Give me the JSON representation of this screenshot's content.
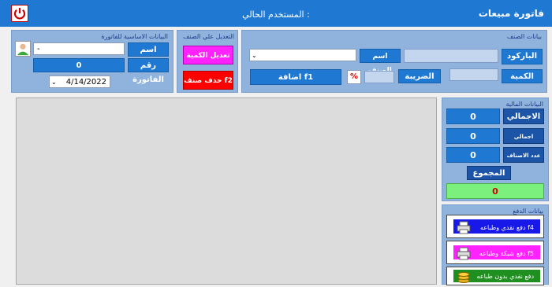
{
  "window": {
    "title": "فاتورة مبيعات",
    "current_user_label": "المستخدم الحالي :"
  },
  "item_data": {
    "heading": "بيانات الصنف",
    "barcode_label": "الباركود",
    "item_name_label": "اسم الصنف",
    "item_name_select": "",
    "quantity_label": "الكمية",
    "tax_label": "الضريبة",
    "percent_symbol": "%",
    "add_button": "اضافة      f1"
  },
  "edit_item": {
    "heading": "التعديل علي الصنف",
    "edit_qty_button": "تعديل الكمية  f3",
    "delete_item_button": "حذف صنف   f2"
  },
  "basic_data": {
    "heading": "البيانات الاساسية للفاتورة",
    "customer_label": "اسم العميل",
    "customer_value": "-",
    "invoice_no_label": "رقم الفاتورة",
    "invoice_no_value": "0",
    "date_value": "4/14/2022"
  },
  "financial": {
    "heading": "البيانات المالية",
    "total_label": "الاجمالي",
    "total_value": "0",
    "tax_total_label": "اجمالي الضريبة",
    "tax_total_value": "0",
    "items_count_label": "عدد الاصناف",
    "items_count_value": "0",
    "sum_button": "المجموع",
    "sum_value": "0"
  },
  "payment": {
    "heading": "بيانات الدفع",
    "cash_print": "دفع نقدي وطباعه   f4",
    "network_print": "دفع شبكة وطباعه   f5",
    "cash_no_print": "دفع نقدي بدون طباعه"
  },
  "colors": {
    "title_blue": "#1f79d2",
    "navy": "#1c55a8",
    "magenta": "#ff22ff",
    "red": "#ff0000",
    "green_sum": "#7cf07c",
    "pay_blue": "#1818e8",
    "pay_green": "#1f8f1f"
  }
}
